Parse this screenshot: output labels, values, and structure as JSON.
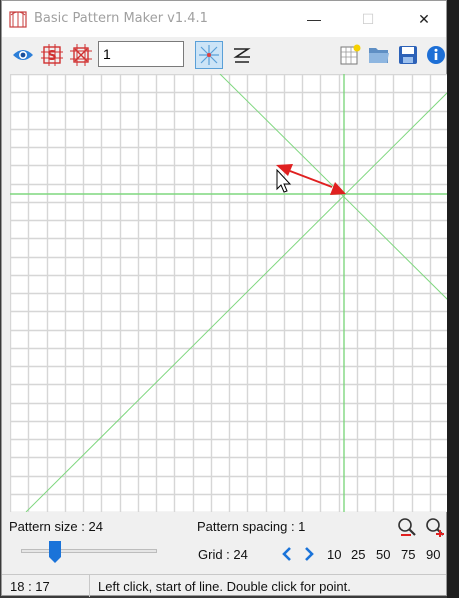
{
  "window": {
    "title": "Basic Pattern Maker v1.4.1",
    "minimize_glyph": "—",
    "maximize_glyph": "☐",
    "close_glyph": "✕"
  },
  "toolbar": {
    "pattern_input_value": "1",
    "icons": [
      "eye-icon",
      "symmetry-s-icon",
      "cross-box-icon",
      "radial-lines-icon",
      "zigzag-icon",
      "new-grid-icon",
      "open-folder-icon",
      "save-disk-icon",
      "info-icon"
    ]
  },
  "controls": {
    "pattern_size_label": "Pattern size : 24",
    "pattern_spacing_label": "Pattern spacing : 1",
    "grid_label": "Grid : 24",
    "slider_level": 0.25,
    "grid_presets": [
      "10",
      "25",
      "50",
      "75",
      "90"
    ]
  },
  "status": {
    "coords": "18 : 17",
    "message": "Left click, start of line.  Double click for point."
  },
  "colors": {
    "grid_line": "#d6d6d6",
    "guide_line": "#7fd77f",
    "arrow": "#e02020",
    "accent_blue": "#1a73d9"
  }
}
